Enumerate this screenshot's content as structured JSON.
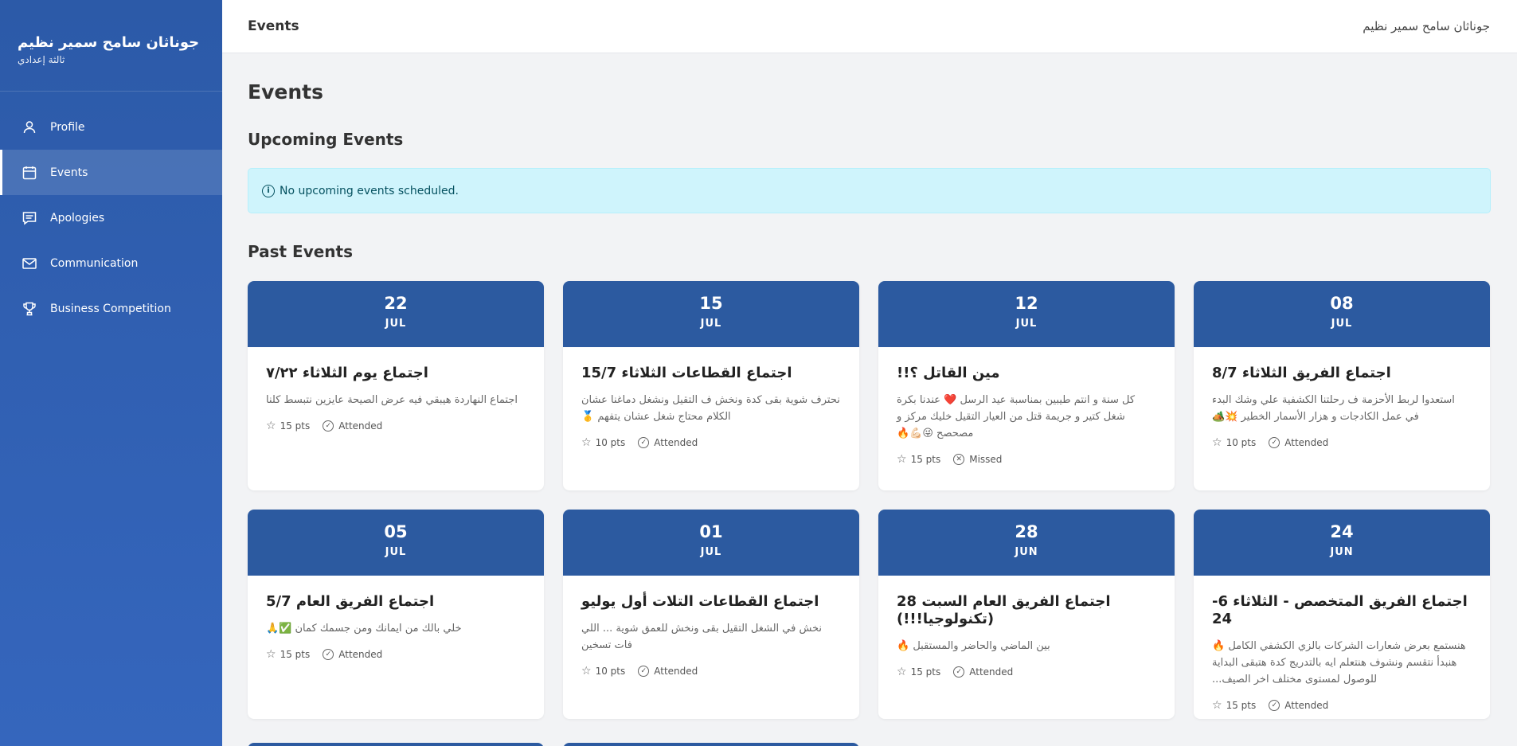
{
  "sidebar": {
    "name": "جوناثان سامح سمير نظيم",
    "grade": "ثالثة إعدادي",
    "items": [
      {
        "label": "Profile",
        "icon": "user-icon"
      },
      {
        "label": "Events",
        "icon": "calendar-icon",
        "active": true
      },
      {
        "label": "Apologies",
        "icon": "message-icon"
      },
      {
        "label": "Communication",
        "icon": "mail-icon"
      },
      {
        "label": "Business Competition",
        "icon": "trophy-icon"
      }
    ]
  },
  "topbar": {
    "title": "Events",
    "user": "جوناثان سامح سمير نظيم"
  },
  "main": {
    "page_title": "Events",
    "upcoming_title": "Upcoming Events",
    "upcoming_empty": "No upcoming events scheduled.",
    "past_title": "Past Events"
  },
  "events": [
    {
      "day": "22",
      "month": "JUL",
      "title": "اجتماع يوم الثلاثاء ٧/٢٢",
      "desc": "اجتماع النهاردة هيبقي فيه عرض الصيحة عايزين نتبسط كلنا",
      "points": "15 pts",
      "status": "Attended"
    },
    {
      "day": "15",
      "month": "JUL",
      "title": "اجتماع القطاعات الثلاثاء 15/7",
      "desc": "نحترف شوية بقى كدة ونخش ف التقيل ونشغل دماغنا عشان الكلام محتاج شغل عشان يتفهم 🥇",
      "points": "10 pts",
      "status": "Attended"
    },
    {
      "day": "12",
      "month": "JUL",
      "title": "مين القاتل ؟!!",
      "desc": "كل سنة و انتم طيبين بمناسبة عيد الرسل ❤️ عندنا بكرة شغل كتير و جريمة قتل من العيار التقيل خليك مركز و مصحصح 😜💪🏻🔥",
      "points": "15 pts",
      "status": "Missed"
    },
    {
      "day": "08",
      "month": "JUL",
      "title": "اجتماع الفريق الثلاثاء 8/7",
      "desc": "استعدوا لربط الأحزمة ف رحلتنا الكشفية علي وشك البدء في عمل الكادجات و هزار الأسمار الخطير 💥🏕️",
      "points": "10 pts",
      "status": "Attended"
    },
    {
      "day": "05",
      "month": "JUL",
      "title": "اجتماع الفريق العام 5/7",
      "desc": "خلي بالك من ايمانك ومن جسمك كمان ✅🙏",
      "points": "15 pts",
      "status": "Attended"
    },
    {
      "day": "01",
      "month": "JUL",
      "title": "اجتماع القطاعات التلات أول يوليو",
      "desc": "نخش في الشغل التقيل بقى ونخش للعمق شوية ... اللي فات تسخين",
      "points": "10 pts",
      "status": "Attended"
    },
    {
      "day": "28",
      "month": "JUN",
      "title": "اجتماع الفريق العام السبت 28 (تكنولوجيا!!!)",
      "desc": "بين الماضي والحاضر والمستقبل 🔥",
      "points": "15 pts",
      "status": "Attended"
    },
    {
      "day": "24",
      "month": "JUN",
      "title": "اجتماع الفريق المتخصص - الثلاثاء 6-24",
      "desc": "هنستمع بعرض شعارات الشركات بالزي الكشفي الكامل 🔥 هنبدأ نتقسم ونشوف هنتعلم ايه بالتدريج كدة هتبقى البداية للوصول لمستوى مختلف اخر الصيف...",
      "points": "15 pts",
      "status": "Attended"
    }
  ]
}
